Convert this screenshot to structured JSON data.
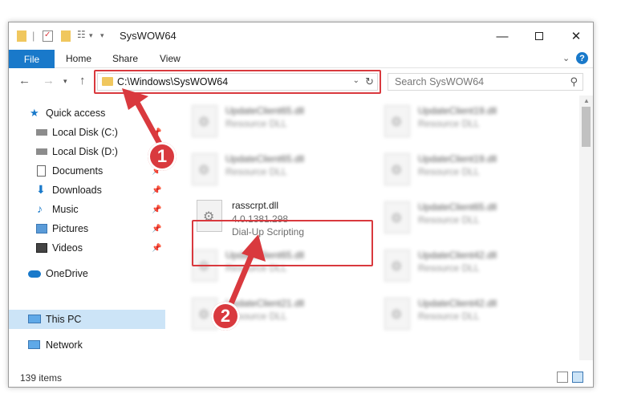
{
  "window": {
    "title": "SysWOW64"
  },
  "ribbon": {
    "tabs": [
      "File",
      "Home",
      "Share",
      "View"
    ],
    "help": "?"
  },
  "address": {
    "path": "C:\\Windows\\SysWOW64"
  },
  "search": {
    "placeholder": "Search SysWOW64"
  },
  "sidebar": {
    "items": [
      {
        "label": "Quick access",
        "icon": "star-icon",
        "pinned": false
      },
      {
        "label": "Local Disk (C:)",
        "icon": "drive-icon",
        "pinned": true
      },
      {
        "label": "Local Disk (D:)",
        "icon": "drive-icon",
        "pinned": false
      },
      {
        "label": "Documents",
        "icon": "document-icon",
        "pinned": true
      },
      {
        "label": "Downloads",
        "icon": "download-icon",
        "pinned": true
      },
      {
        "label": "Music",
        "icon": "music-icon",
        "pinned": true
      },
      {
        "label": "Pictures",
        "icon": "pictures-icon",
        "pinned": true
      },
      {
        "label": "Videos",
        "icon": "videos-icon",
        "pinned": true
      },
      {
        "label": "OneDrive",
        "icon": "cloud-icon",
        "pinned": false
      },
      {
        "label": "This PC",
        "icon": "computer-icon",
        "pinned": false,
        "selected": true
      },
      {
        "label": "Network",
        "icon": "network-icon",
        "pinned": false
      }
    ]
  },
  "files": {
    "left": [
      {
        "name": "UpdateClient65.dll",
        "desc": "Resource DLL"
      },
      {
        "name": "UpdateClient65.dll",
        "desc": "Resource DLL"
      },
      {
        "name": "rasscrpt.dll",
        "version": "4.0.1381.298",
        "desc": "Dial-Up Scripting"
      },
      {
        "name": "UpdateClient65.dll",
        "desc": "Resource DLL"
      },
      {
        "name": "UpdateClient21.dll",
        "desc": "Resource DLL"
      }
    ],
    "right": [
      {
        "name": "UpdateClient19.dll",
        "desc": "Resource DLL"
      },
      {
        "name": "UpdateClient19.dll",
        "desc": "Resource DLL"
      },
      {
        "name": "UpdateClient65.dll",
        "desc": "Resource DLL"
      },
      {
        "name": "UpdateClient42.dll",
        "desc": "Resource DLL"
      },
      {
        "name": "UpdateClient42.dll",
        "desc": "Resource DLL"
      }
    ]
  },
  "status": {
    "count": "139 items"
  },
  "annotations": {
    "step1": "1",
    "step2": "2",
    "color": "#d9393e"
  }
}
